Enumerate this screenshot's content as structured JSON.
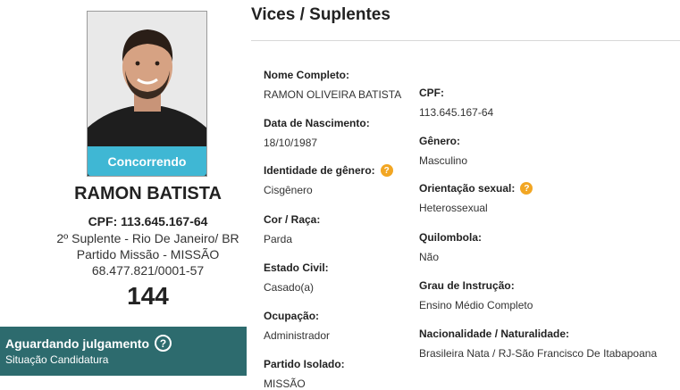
{
  "candidate": {
    "status_pill": "Concorrendo",
    "name": "RAMON BATISTA",
    "cpf_line": "CPF: 113.645.167-64",
    "position_line": "2º Suplente - Rio De Janeiro/ BR",
    "party_line": "Partido Missão - MISSÃO",
    "cnpj_line": "68.477.821/0001-57",
    "number": "144",
    "judgement_title": "Aguardando julgamento",
    "judgement_subtitle": "Situação Candidatura"
  },
  "section": {
    "title": "Vices / Suplentes"
  },
  "fields": {
    "nome_completo": {
      "label": "Nome Completo:",
      "value": "RAMON OLIVEIRA BATISTA"
    },
    "data_nascimento": {
      "label": "Data de Nascimento:",
      "value": "18/10/1987"
    },
    "identidade_genero": {
      "label": "Identidade de gênero:",
      "value": "Cisgênero"
    },
    "cor_raca": {
      "label": "Cor / Raça:",
      "value": "Parda"
    },
    "estado_civil": {
      "label": "Estado Civil:",
      "value": "Casado(a)"
    },
    "ocupacao": {
      "label": "Ocupação:",
      "value": "Administrador"
    },
    "partido_isolado": {
      "label": "Partido Isolado:",
      "value": "MISSÃO"
    },
    "cpf": {
      "label": "CPF:",
      "value": "113.645.167-64"
    },
    "genero": {
      "label": "Gênero:",
      "value": "Masculino"
    },
    "orientacao_sexual": {
      "label": "Orientação sexual:",
      "value": "Heterossexual"
    },
    "quilombola": {
      "label": "Quilombola:",
      "value": "Não"
    },
    "grau_instrucao": {
      "label": "Grau de Instrução:",
      "value": "Ensino Médio Completo"
    },
    "nacionalidade": {
      "label": "Nacionalidade / Naturalidade:",
      "value": "Brasileira Nata / RJ-São Francisco De Itabapoana"
    }
  },
  "icons": {
    "help": "question-circle-icon",
    "info": "info-badge-icon"
  },
  "colors": {
    "status_pill": "#3fb7d4",
    "judgement_box": "#2d6b6e",
    "info_badge": "#f2a623"
  }
}
